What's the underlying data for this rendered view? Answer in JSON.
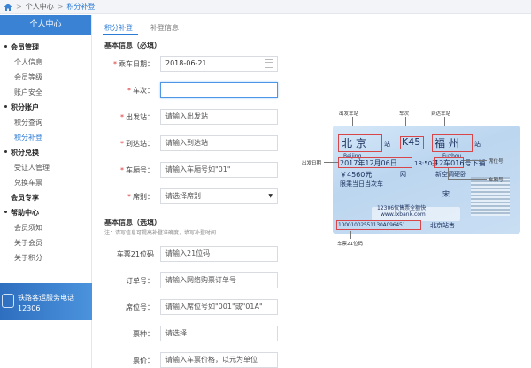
{
  "breadcrumb": {
    "items": [
      "个人中心",
      "积分补登"
    ],
    "separator": ">"
  },
  "sidebar": {
    "title": "个人中心",
    "groups": [
      {
        "label": "会员管理",
        "items": [
          "个人信息",
          "会员等级",
          "账户安全"
        ]
      },
      {
        "label": "积分账户",
        "items": [
          "积分查询",
          "积分补登"
        ]
      },
      {
        "label": "积分兑换",
        "items": [
          "受让人管理",
          "兑换车票"
        ]
      },
      {
        "label": "会员专享",
        "items": []
      },
      {
        "label": "帮助中心",
        "items": [
          "会员须知",
          "关于会员",
          "关于积分"
        ]
      }
    ],
    "active_item": "积分补登",
    "banner": {
      "line1": "铁路客运服务电话",
      "line2": "12306"
    }
  },
  "tabs": [
    {
      "label": "积分补登",
      "active": true
    },
    {
      "label": "补登信息",
      "active": false
    }
  ],
  "section_required": {
    "title": "基本信息（必填）"
  },
  "section_optional": {
    "title": "基本信息（选填）",
    "note": "注：请写信息可提高补登准确度，填写补登时间"
  },
  "required_fields": [
    {
      "label": "乘车日期：",
      "value": "2018-06-21",
      "icon": "calendar-icon"
    },
    {
      "label": "车次：",
      "value": ""
    },
    {
      "label": "出发站：",
      "placeholder": "请输入出发站"
    },
    {
      "label": "到达站：",
      "placeholder": "请输入到达站"
    },
    {
      "label": "车厢号：",
      "placeholder": "请输入车厢号如\"01\""
    },
    {
      "label": "席别：",
      "placeholder": "请选择席别"
    }
  ],
  "optional_fields": [
    {
      "label": "车票21位码",
      "placeholder": "请输入21位码"
    },
    {
      "label": "订单号：",
      "placeholder": "请输入网络购票订单号"
    },
    {
      "label": "席位号：",
      "placeholder": "请输入席位号如\"001\"或\"01A\""
    },
    {
      "label": "票种：",
      "placeholder": "请选择"
    },
    {
      "label": "票价：",
      "placeholder": "请输入车票价格，以元为单位"
    }
  ],
  "ticket": {
    "from_cn": "北 京",
    "from_py": "Beijing",
    "from_suffix": "站",
    "train": "K45",
    "to_cn": "福 州",
    "to_py": "Fuzhou",
    "to_suffix": "站",
    "date": "2017年12月06日",
    "date_tail": "18:50开",
    "car_seat": "12车016号下铺",
    "price": "￥4560元",
    "seat_type": "新空调硬卧",
    "net": "网",
    "notice": "限乘当日当次车",
    "name_tail": "宋",
    "slogan": "12306仅售票全额快！",
    "site": "www.lxbank.com",
    "code21": "10001002551130A096451",
    "office": "北京站售"
  },
  "ticket_annotations": {
    "from_station": "出发车站",
    "train_no": "车次",
    "to_station": "到达车站",
    "depart_date": "出发日期",
    "seat_no": "席位号",
    "car_no": "车厢号",
    "code21": "车票21位码"
  },
  "colors": {
    "accent": "#2a7bd6",
    "sidebar_header": "#3a83d4",
    "required_mark": "#dd3333",
    "highlight": "#d9464a"
  }
}
